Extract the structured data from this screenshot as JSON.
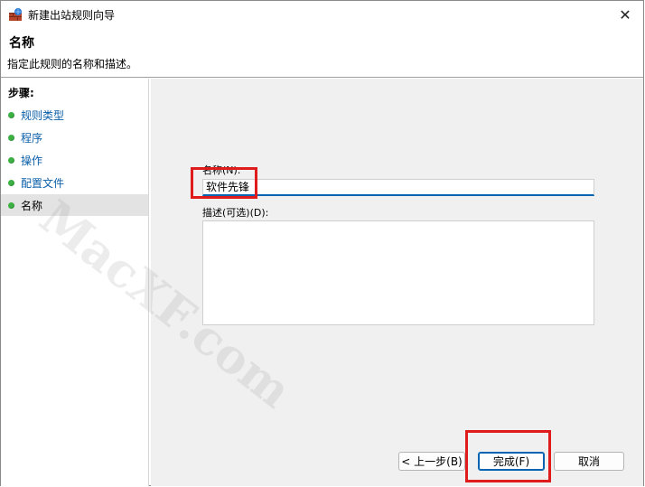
{
  "window": {
    "title": "新建出站规则向导",
    "close_glyph": "✕"
  },
  "header": {
    "title": "名称",
    "description": "指定此规则的名称和描述。"
  },
  "sidebar": {
    "steps_label": "步骤:",
    "items": [
      {
        "label": "规则类型",
        "active": false
      },
      {
        "label": "程序",
        "active": false
      },
      {
        "label": "操作",
        "active": false
      },
      {
        "label": "配置文件",
        "active": false
      },
      {
        "label": "名称",
        "active": true
      }
    ]
  },
  "form": {
    "name_label": "名称(N):",
    "name_value": "软件先锋",
    "description_label": "描述(可选)(D):",
    "description_value": ""
  },
  "buttons": {
    "prev": "< 上一步(B)",
    "finish": "完成(F)",
    "cancel": "取消"
  },
  "watermark": "MacXF.com",
  "colors": {
    "accent": "#0063b1",
    "step_dot": "#3cb043",
    "highlight": "#e01b1b",
    "link": "#0b5fa8"
  }
}
